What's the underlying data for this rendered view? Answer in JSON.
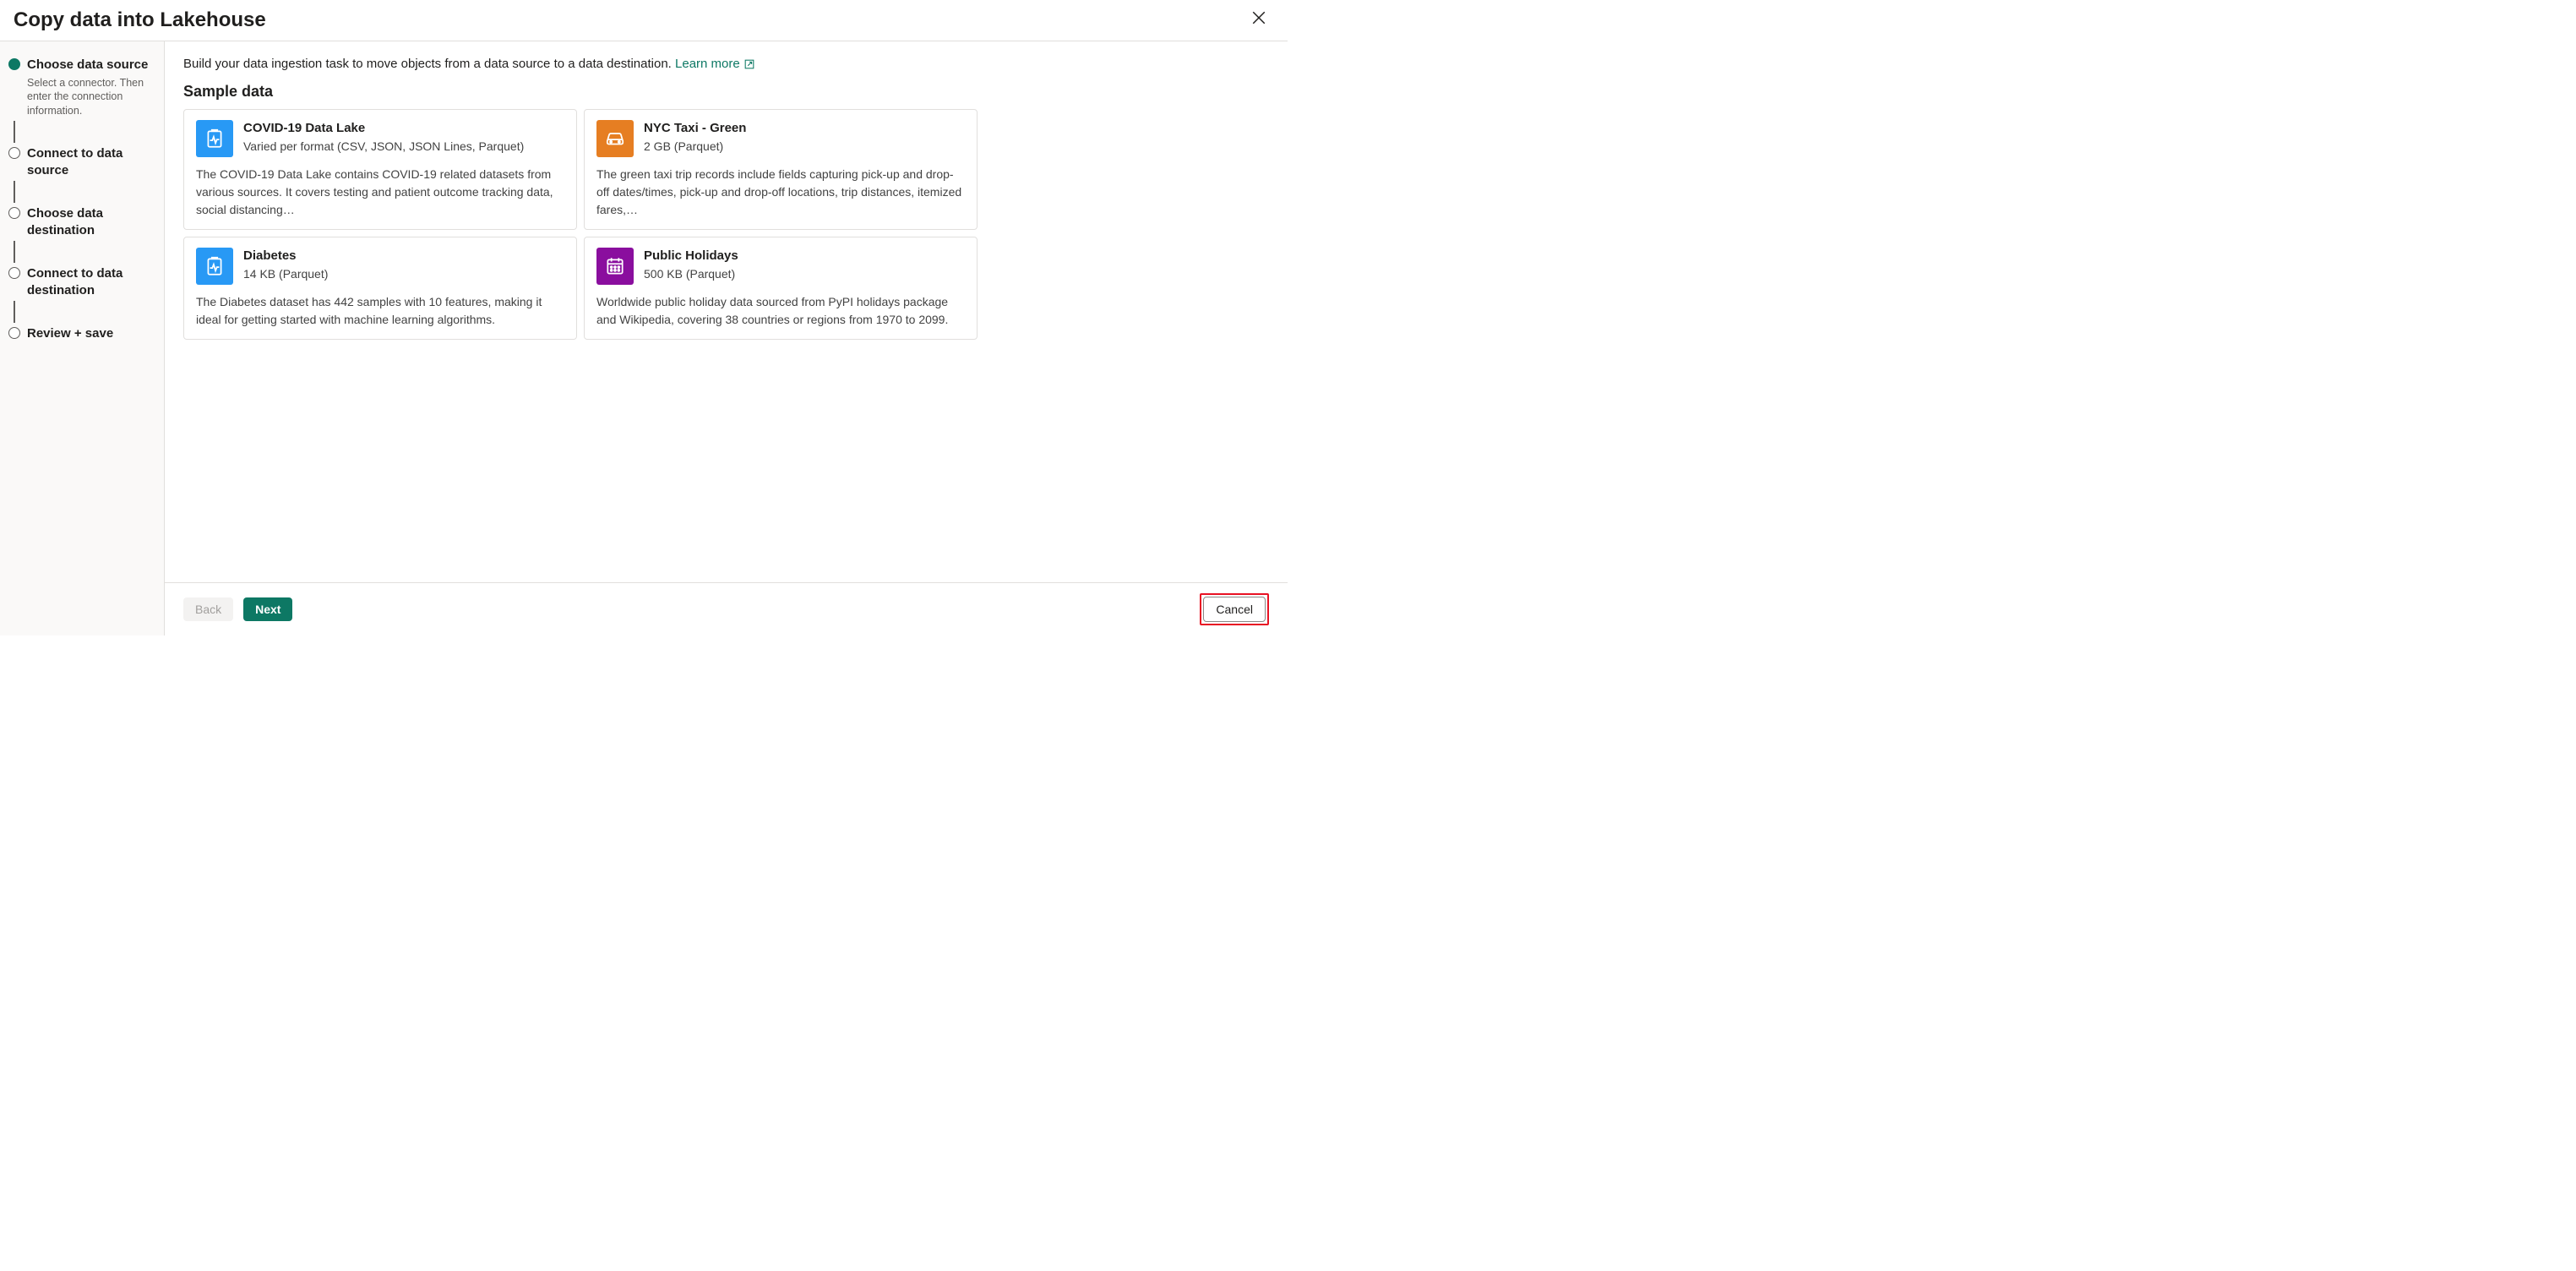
{
  "dialog": {
    "title": "Copy data into Lakehouse"
  },
  "steps": [
    {
      "title": "Choose data source",
      "desc": "Select a connector. Then enter the connection information."
    },
    {
      "title": "Connect to data source"
    },
    {
      "title": "Choose data destination"
    },
    {
      "title": "Connect to data destination"
    },
    {
      "title": "Review + save"
    }
  ],
  "main": {
    "intro": "Build your data ingestion task to move objects from a data source to a data destination. ",
    "learn_more": "Learn more",
    "section_title": "Sample data"
  },
  "cards": [
    {
      "title": "COVID-19 Data Lake",
      "subtitle": "Varied per format (CSV, JSON, JSON Lines, Parquet)",
      "desc": "The COVID-19 Data Lake contains COVID-19 related datasets from various sources. It covers testing and patient outcome tracking data, social distancing…",
      "icon": "clipboard-pulse-icon",
      "color": "blue"
    },
    {
      "title": "NYC Taxi - Green",
      "subtitle": "2 GB (Parquet)",
      "desc": "The green taxi trip records include fields capturing pick-up and drop-off dates/times, pick-up and drop-off locations, trip distances, itemized fares,…",
      "icon": "car-icon",
      "color": "orange"
    },
    {
      "title": "Diabetes",
      "subtitle": "14 KB (Parquet)",
      "desc": "The Diabetes dataset has 442 samples with 10 features, making it ideal for getting started with machine learning algorithms.",
      "icon": "clipboard-pulse-icon",
      "color": "blue"
    },
    {
      "title": "Public Holidays",
      "subtitle": "500 KB (Parquet)",
      "desc": "Worldwide public holiday data sourced from PyPI holidays package and Wikipedia, covering 38 countries or regions from 1970 to 2099.",
      "icon": "calendar-icon",
      "color": "purple"
    }
  ],
  "footer": {
    "back": "Back",
    "next": "Next",
    "cancel": "Cancel"
  }
}
